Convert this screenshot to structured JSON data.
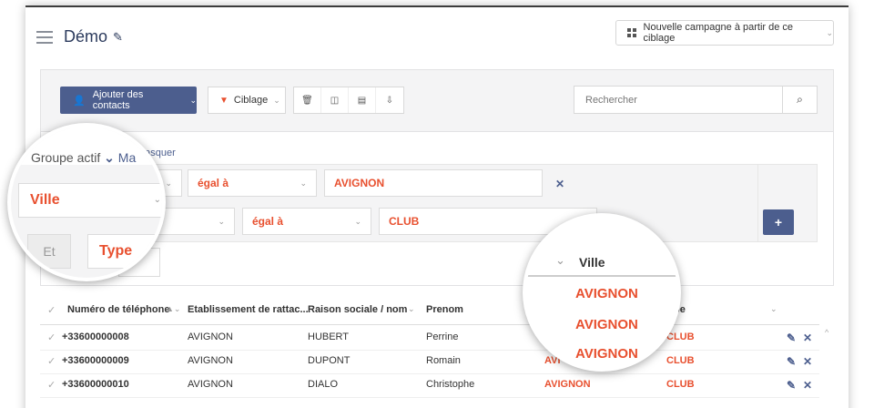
{
  "header": {
    "title": "Démo",
    "campaign_button": "Nouvelle campagne à partir de ce ciblage"
  },
  "toolbar": {
    "add_contacts": "Ajouter des contacts",
    "ciblage": "Ciblage",
    "search_placeholder": "Rechercher"
  },
  "filters": {
    "group_label": "Groupe actif",
    "hide_label": "Masquer",
    "hide_label_partial": "Ma",
    "row1": {
      "field": "Ville",
      "operator": "égal à",
      "value": "AVIGNON"
    },
    "row2": {
      "field": "Type",
      "operator": "égal à",
      "value": "CLUB"
    },
    "connector": "Et"
  },
  "table": {
    "columns": [
      "Numéro de téléphone",
      "Etablissement de rattac...",
      "Raison sociale / nom",
      "Prenom",
      "Ville",
      "Type"
    ],
    "type_header_partial": "pe",
    "rows": [
      {
        "phone": "+33600000008",
        "etab": "AVIGNON",
        "raison": "HUBERT",
        "prenom": "Perrine",
        "ville": "AVIGNON",
        "type": "CLUB"
      },
      {
        "phone": "+33600000009",
        "etab": "AVIGNON",
        "raison": "DUPONT",
        "prenom": "Romain",
        "ville": "AVIGNON",
        "type": "CLUB"
      },
      {
        "phone": "+33600000010",
        "etab": "AVIGNON",
        "raison": "DIALO",
        "prenom": "Christophe",
        "ville": "AVIGNON",
        "type": "CLUB"
      }
    ],
    "ville_partial": "AVI"
  },
  "magnifier2": {
    "header": "Ville",
    "values": [
      "AVIGNON",
      "AVIGNON",
      "AVIGNON"
    ]
  },
  "colors": {
    "accent": "#4c5e8e",
    "highlight": "#e8502f"
  }
}
